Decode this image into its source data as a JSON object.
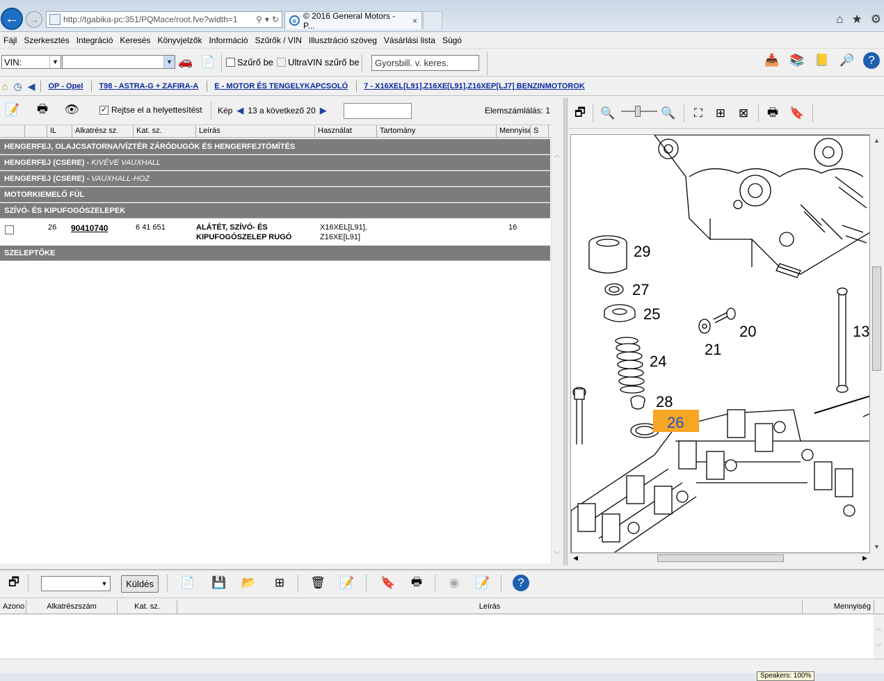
{
  "browser": {
    "url": "http://tgabika-pc:351/PQMace/root.fve?width=1",
    "tab_title": "© 2016 General Motors - P...",
    "tab_close": "×"
  },
  "menu": [
    "Fájl",
    "Szerkesztés",
    "Integráció",
    "Keresés",
    "Könyvjelzők",
    "Információ",
    "Szűrők / VIN",
    "Illusztráció szöveg",
    "Vásárlási lista",
    "Súgó"
  ],
  "vin_toolbar": {
    "vin_label": "VIN:",
    "vin_value": "",
    "filter_label": "Szűrő be",
    "ultravin_label": "UltraVIN szűrő be",
    "quick_search_placeholder": "Gyorsbill. v. keres."
  },
  "breadcrumb": [
    "OP - Opel",
    "T98 - ASTRA-G + ZAFIRA-A",
    "E - MOTOR ÉS TENGELYKAPCSOLÓ",
    "7 - X16XEL[L91],Z16XE[L91],Z16XEP[LJ7] BENZINMOTOROK"
  ],
  "parts_toolbar": {
    "hide_label": "Rejtse el a helyettesítést",
    "image_label": "Kép",
    "image_pager": "13 a következő 20",
    "element_count": "Elemszámlálás: 1"
  },
  "parts_columns": [
    "",
    "",
    "IL",
    "Alkatrész sz.",
    "Kat. sz.",
    "Leírás",
    "Használat",
    "Tartomány",
    "Mennyisé",
    "S"
  ],
  "groups": [
    {
      "title": "HENGERFEJ, OLAJCSATORNA/VÍZTÉR ZÁRÓDUGÓK ÉS HENGERFEJTÖMÍTÉS",
      "note": ""
    },
    {
      "title": "HENGERFEJ (CSERE) - ",
      "note": "KIVÉVE VAUXHALL"
    },
    {
      "title": "HENGERFEJ (CSERE) - ",
      "note": "VAUXHALL-HOZ"
    },
    {
      "title": "MOTORKIEMELŐ FÜL",
      "note": ""
    },
    {
      "title": "SZÍVÓ- ÉS KIPUFOGÓSZELEPEK",
      "note": ""
    }
  ],
  "part": {
    "il": "26",
    "part_no": "90410740",
    "cat_no": "6 41 651",
    "description_line1": "ALÁTÉT, SZÍVÓ- ÉS",
    "description_line2": "KIPUFOGÓSZELEP RUGÓ",
    "usage_line1": "X16XEL[L91],",
    "usage_line2": "Z16XE[L91]",
    "quantity": "16"
  },
  "group_after": "SZELEPTŐKE",
  "drawing_callouts": [
    "29",
    "27",
    "25",
    "24",
    "28",
    "26",
    "20",
    "21",
    "13"
  ],
  "highlighted_callout": "26",
  "bottom": {
    "send_label": "Küldés",
    "columns": [
      "Azono",
      "Alkatrészszám",
      "Kat. sz.",
      "Leírás",
      "Mennyiség"
    ]
  },
  "speakers": "Speakers: 100%",
  "colors": {
    "group_bg": "#7c7c7c",
    "highlight": "#f5a623",
    "link": "#0a2aa0"
  }
}
